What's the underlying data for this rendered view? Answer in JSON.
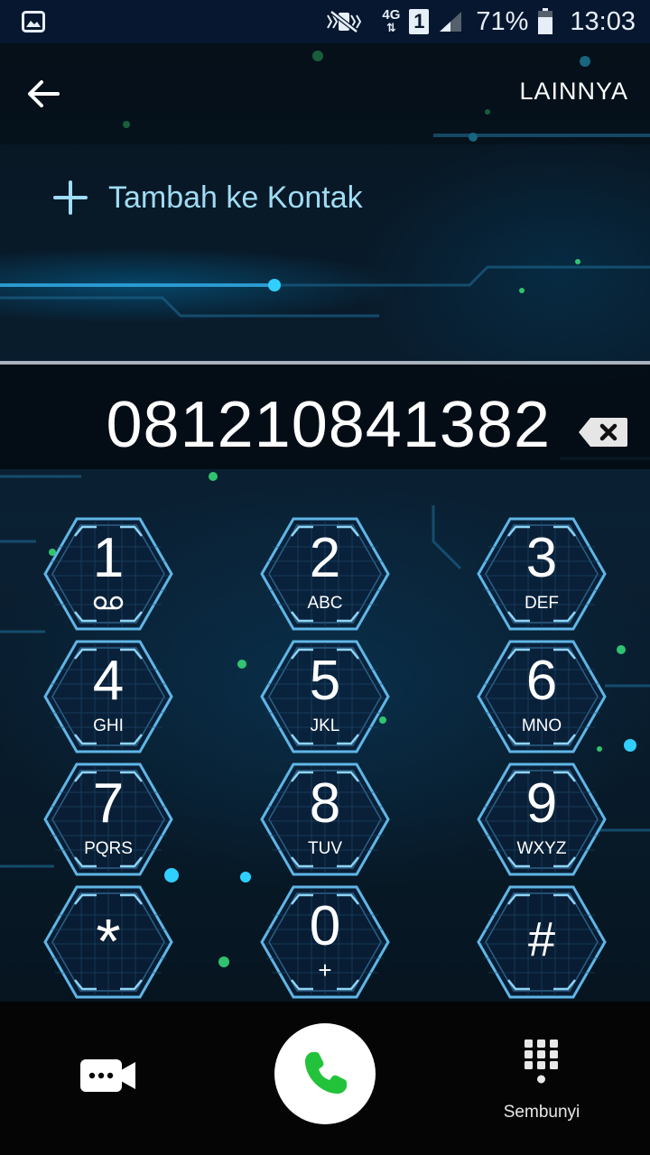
{
  "status_bar": {
    "network": "4G",
    "sim": "1",
    "battery": "71%",
    "time": "13:03",
    "icons": [
      "gallery-icon",
      "mute-vibrate-icon",
      "network-4g-icon",
      "sim-1-icon",
      "signal-icon",
      "battery-icon"
    ]
  },
  "app_bar": {
    "back_icon": "arrow-left-icon",
    "more_label": "LAINNYA"
  },
  "add_contact": {
    "icon": "plus-icon",
    "label": "Tambah ke Kontak"
  },
  "dialer": {
    "number": "081210841382",
    "backspace_icon": "backspace-icon"
  },
  "keypad": {
    "keys": [
      {
        "digit": "1",
        "letters": "",
        "icon": "voicemail-icon"
      },
      {
        "digit": "2",
        "letters": "ABC"
      },
      {
        "digit": "3",
        "letters": "DEF"
      },
      {
        "digit": "4",
        "letters": "GHI"
      },
      {
        "digit": "5",
        "letters": "JKL"
      },
      {
        "digit": "6",
        "letters": "MNO"
      },
      {
        "digit": "7",
        "letters": "PQRS"
      },
      {
        "digit": "8",
        "letters": "TUV"
      },
      {
        "digit": "9",
        "letters": "WXYZ"
      },
      {
        "digit": "*",
        "letters": ""
      },
      {
        "digit": "0",
        "letters": "+"
      },
      {
        "digit": "#",
        "letters": ""
      }
    ]
  },
  "bottom_bar": {
    "video_icon": "video-call-icon",
    "call_icon": "phone-icon",
    "hide_icon": "keypad-grid-icon",
    "hide_label": "Sembunyi"
  },
  "colors": {
    "status_bar_bg": "#07172f",
    "accent_cyan": "#6cc7f0",
    "call_green": "#22c33a",
    "add_contact_text": "#9fdcf5"
  }
}
